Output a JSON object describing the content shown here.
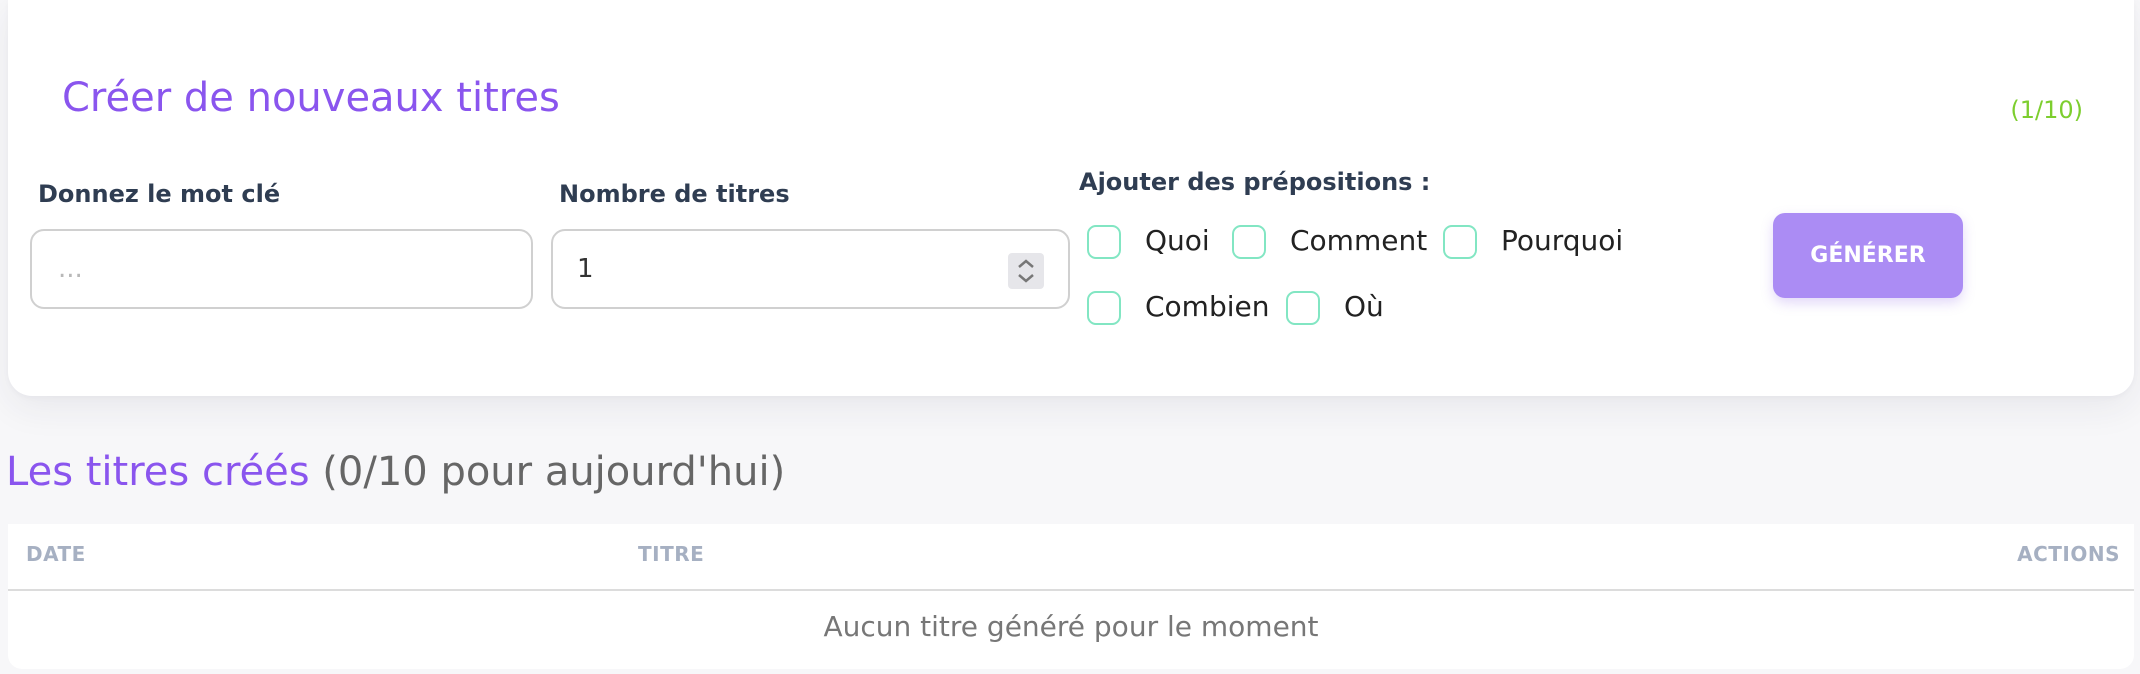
{
  "form": {
    "title": "Créer de nouveaux titres",
    "counter": "(1/10)",
    "keyword": {
      "label": "Donnez le mot clé",
      "placeholder": "...",
      "value": ""
    },
    "count": {
      "label": "Nombre de titres",
      "value": "1"
    },
    "prepositions": {
      "label": "Ajouter des prépositions :",
      "options": [
        {
          "label": "Quoi",
          "checked": false
        },
        {
          "label": "Comment",
          "checked": false
        },
        {
          "label": "Pourquoi",
          "checked": false
        },
        {
          "label": "Combien",
          "checked": false
        },
        {
          "label": "Où",
          "checked": false
        }
      ]
    },
    "generate_label": "GÉNÉRER"
  },
  "list": {
    "title": "Les titres créés",
    "subtitle": "(0/10 pour aujourd'hui)",
    "columns": {
      "date": "DATE",
      "title": "TITRE",
      "actions": "ACTIONS"
    },
    "empty_message": "Aucun titre généré pour le moment"
  },
  "colors": {
    "accent": "#8a55ee",
    "button": "#ab8cf4",
    "counter": "#7dce2f",
    "checkbox_border": "#82e6c3"
  },
  "icons": {
    "number_spinner": "chevron-up-down-icon"
  }
}
